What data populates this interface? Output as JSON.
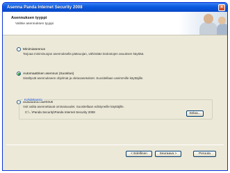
{
  "window": {
    "title": "Asenna Panda Internet Security 2008"
  },
  "header": {
    "title": "Asennuksen tyyppi",
    "subtitle": "Valitse asennuksen tyyppi"
  },
  "options": [
    {
      "label": "Minimiasennus",
      "description": "Tarjoaa minimisuojan asennuksella pääsuojan, vähintään tiedostojen asuuksen käyttää.",
      "checked": false
    },
    {
      "label": "Automaattinen asennus (Suositus)",
      "description": "Sisältyvät asennukseen ohjelmat ja oletusasetukset. Suositellaan useimmille käyttäjille.",
      "checked": true
    },
    {
      "label": "Mukautettu asennus",
      "description": "Voit valita asennettavat ominaisuudet. Suositellaan edistyneille käyttäjille.",
      "checked": false
    }
  ],
  "install_path": {
    "legend": "Kohdekansio",
    "path": "C:\\...\\Panda Security\\Panda Internet Security 2008",
    "browse_label": "Selaa..."
  },
  "footer": {
    "back_label": "< Edellinen",
    "next_label": "Seuraava >",
    "cancel_label": "Peruuta"
  }
}
